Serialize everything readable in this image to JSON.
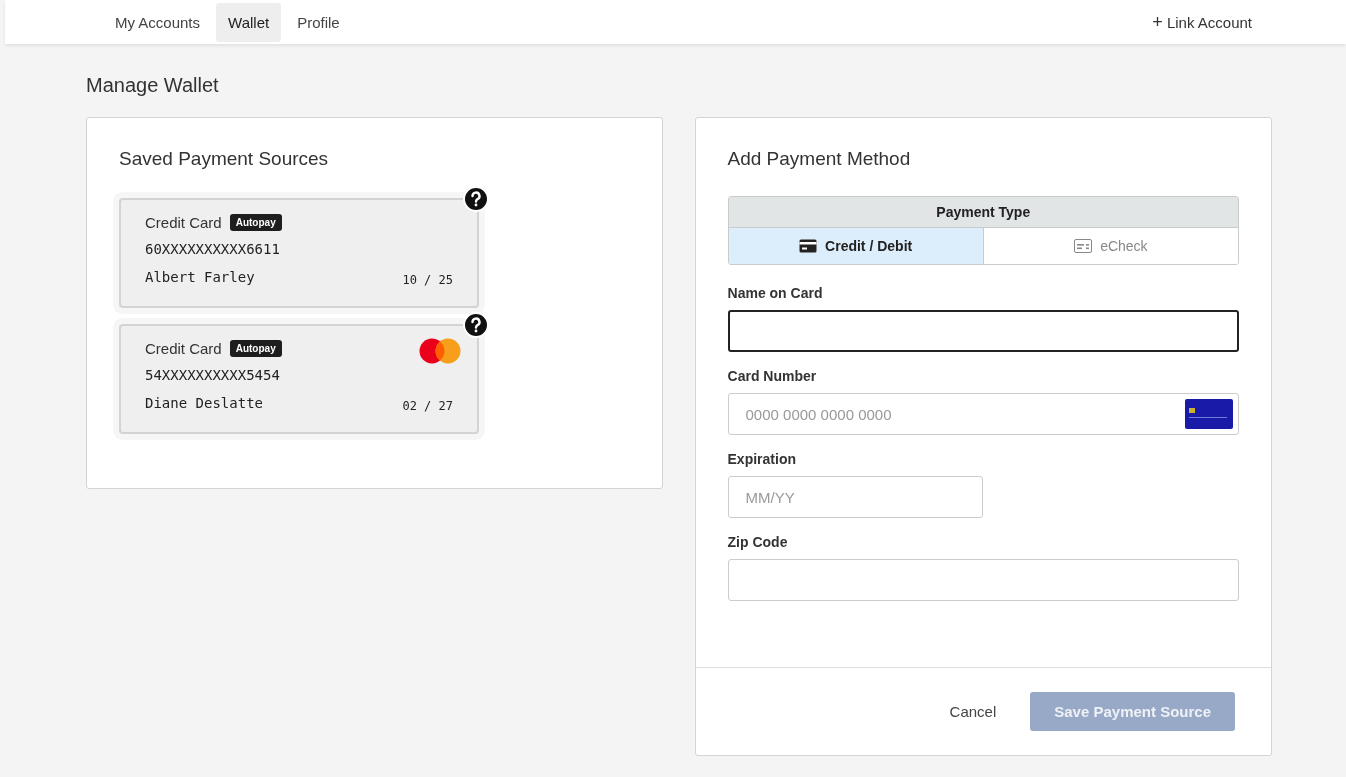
{
  "nav": {
    "tabs": [
      {
        "label": "My Accounts",
        "selected": false
      },
      {
        "label": "Wallet",
        "selected": true
      },
      {
        "label": "Profile",
        "selected": false
      }
    ],
    "link_account": {
      "icon": "+",
      "label": "Link Account"
    }
  },
  "page_title": "Manage Wallet",
  "saved": {
    "title": "Saved Payment Sources",
    "cards": [
      {
        "type": "Credit Card",
        "autopay": true,
        "autopay_label": "Autopay",
        "number": "60XXXXXXXXXX6611",
        "holder": "Albert Farley",
        "expiry": "10 / 25",
        "logo": false
      },
      {
        "type": "Credit Card",
        "autopay": true,
        "autopay_label": "Autopay",
        "number": "54XXXXXXXXXX5454",
        "holder": "Diane Deslatte",
        "expiry": "02 / 27",
        "logo": true
      }
    ]
  },
  "add": {
    "title": "Add Payment Method",
    "payment_type": {
      "heading": "Payment Type",
      "options": [
        {
          "label": "Credit / Debit",
          "kind": "card",
          "selected": true
        },
        {
          "label": "eCheck",
          "kind": "check",
          "selected": false
        }
      ]
    },
    "fields": [
      {
        "label": "Name on Card",
        "kind": "text",
        "focused": true
      },
      {
        "label": "Card Number",
        "kind": "card-number",
        "placeholder": "0000 0000 0000 0000",
        "focused": false
      },
      {
        "label": "Expiration",
        "kind": "short",
        "placeholder": "MM/YY",
        "focused": false
      },
      {
        "label": "Zip Code",
        "kind": "text",
        "focused": false
      }
    ],
    "cancel": "Cancel",
    "save": {
      "label": "Save Payment Source",
      "disabled": true
    }
  }
}
